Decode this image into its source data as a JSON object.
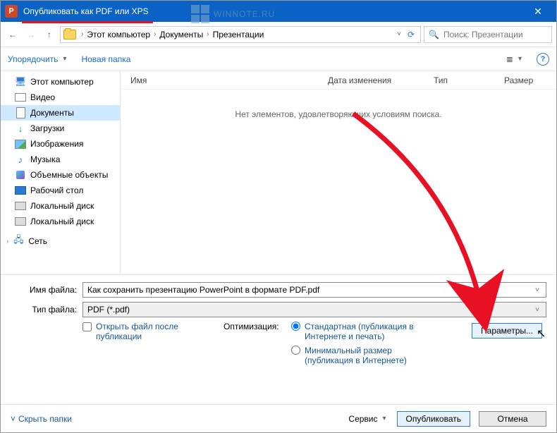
{
  "title": "Опубликовать как PDF или XPS",
  "app_icon_letter": "P",
  "breadcrumb": [
    "Этот компьютер",
    "Документы",
    "Презентации"
  ],
  "search_placeholder": "Поиск: Презентации",
  "toolbar": {
    "organize": "Упорядочить",
    "new_folder": "Новая папка"
  },
  "sidebar": {
    "items": [
      {
        "label": "Этот компьютер"
      },
      {
        "label": "Видео"
      },
      {
        "label": "Документы"
      },
      {
        "label": "Загрузки"
      },
      {
        "label": "Изображения"
      },
      {
        "label": "Музыка"
      },
      {
        "label": "Объемные объекты"
      },
      {
        "label": "Рабочий стол"
      },
      {
        "label": "Локальный диск"
      },
      {
        "label": "Локальный диск"
      }
    ],
    "network": "Сеть"
  },
  "columns": {
    "name": "Имя",
    "date": "Дата изменения",
    "type": "Тип",
    "size": "Размер"
  },
  "empty_msg": "Нет элементов, удовлетворяющих условиям поиска.",
  "filename_label": "Имя файла:",
  "filename_value": "Как сохранить презентацию PowerPoint в формате PDF.pdf",
  "filetype_label": "Тип файла:",
  "filetype_value": "PDF (*.pdf)",
  "open_after": "Открыть файл после публикации",
  "optimize_label": "Оптимизация:",
  "opt_standard": "Стандартная (публикация в Интернете и печать)",
  "opt_minimal": "Минимальный размер (публикация в Интернете)",
  "options_btn": "Параметры...",
  "hide_folders": "Скрыть папки",
  "service": "Сервис",
  "publish": "Опубликовать",
  "cancel": "Отмена",
  "watermark": "WINNOTE.RU"
}
